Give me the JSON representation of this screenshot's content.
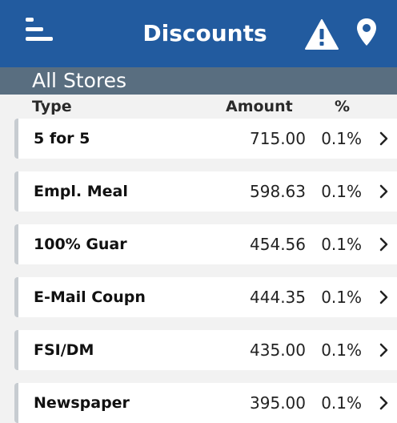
{
  "header": {
    "title": "Discounts",
    "menu_icon": "menu-icon",
    "alert_icon": "warning-icon",
    "location_icon": "location-pin-icon"
  },
  "subheader": {
    "label": "All Stores"
  },
  "columns": {
    "type": "Type",
    "amount": "Amount",
    "percent": "%"
  },
  "rows": [
    {
      "type": "5 for 5",
      "amount": "715.00",
      "percent": "0.1%"
    },
    {
      "type": "Empl. Meal",
      "amount": "598.63",
      "percent": "0.1%"
    },
    {
      "type": "100% Guar",
      "amount": "454.56",
      "percent": "0.1%"
    },
    {
      "type": "E-Mail Coupn",
      "amount": "444.35",
      "percent": "0.1%"
    },
    {
      "type": "FSI/DM",
      "amount": "435.00",
      "percent": "0.1%"
    },
    {
      "type": "Newspaper",
      "amount": "395.00",
      "percent": "0.1%"
    }
  ],
  "colors": {
    "header_bg": "#225b9f",
    "subheader_bg": "#596e80",
    "row_accent": "#c7ccd1"
  }
}
